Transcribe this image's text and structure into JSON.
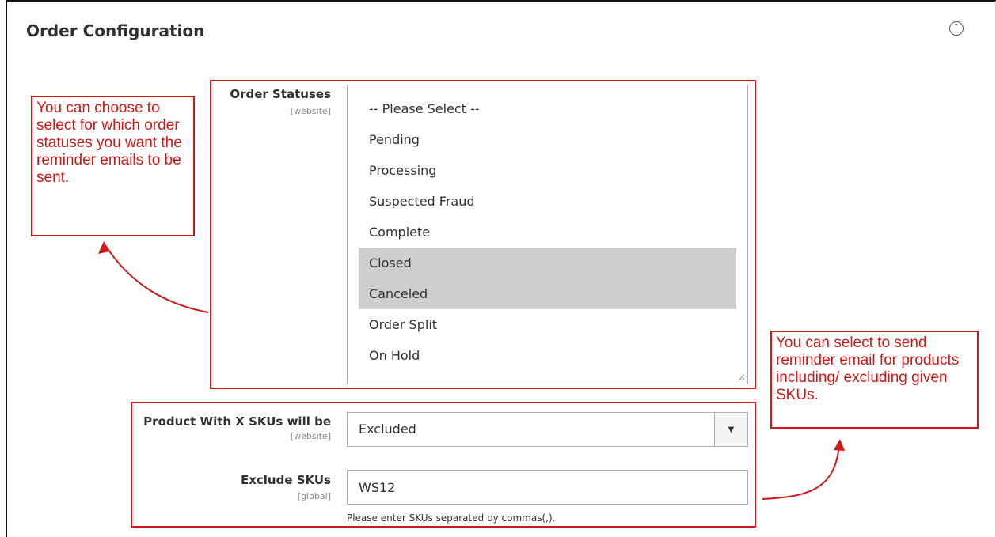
{
  "section": {
    "title": "Order Configuration"
  },
  "order_statuses": {
    "label": "Order Statuses",
    "scope": "[website]",
    "options": [
      {
        "label": "-- Please Select --",
        "selected": false
      },
      {
        "label": "Pending",
        "selected": false
      },
      {
        "label": "Processing",
        "selected": false
      },
      {
        "label": "Suspected Fraud",
        "selected": false
      },
      {
        "label": "Complete",
        "selected": false
      },
      {
        "label": "Closed",
        "selected": true
      },
      {
        "label": "Canceled",
        "selected": true
      },
      {
        "label": "Order Split",
        "selected": false
      },
      {
        "label": "On Hold",
        "selected": false
      }
    ]
  },
  "sku_mode": {
    "label": "Product With X SKUs will be",
    "scope": "[website]",
    "value": "Excluded"
  },
  "exclude_skus": {
    "label": "Exclude SKUs",
    "scope": "[global]",
    "value": "WS12",
    "note": "Please enter SKUs separated by commas(,)."
  },
  "annotations": {
    "statuses_callout": "You can choose to select for which order statuses you want the reminder emails to be sent.",
    "sku_callout": "You can select to send reminder email for products including/ excluding given SKUs."
  },
  "colors": {
    "annotation_red": "#d01818",
    "selected_option_bg": "#cecece"
  }
}
